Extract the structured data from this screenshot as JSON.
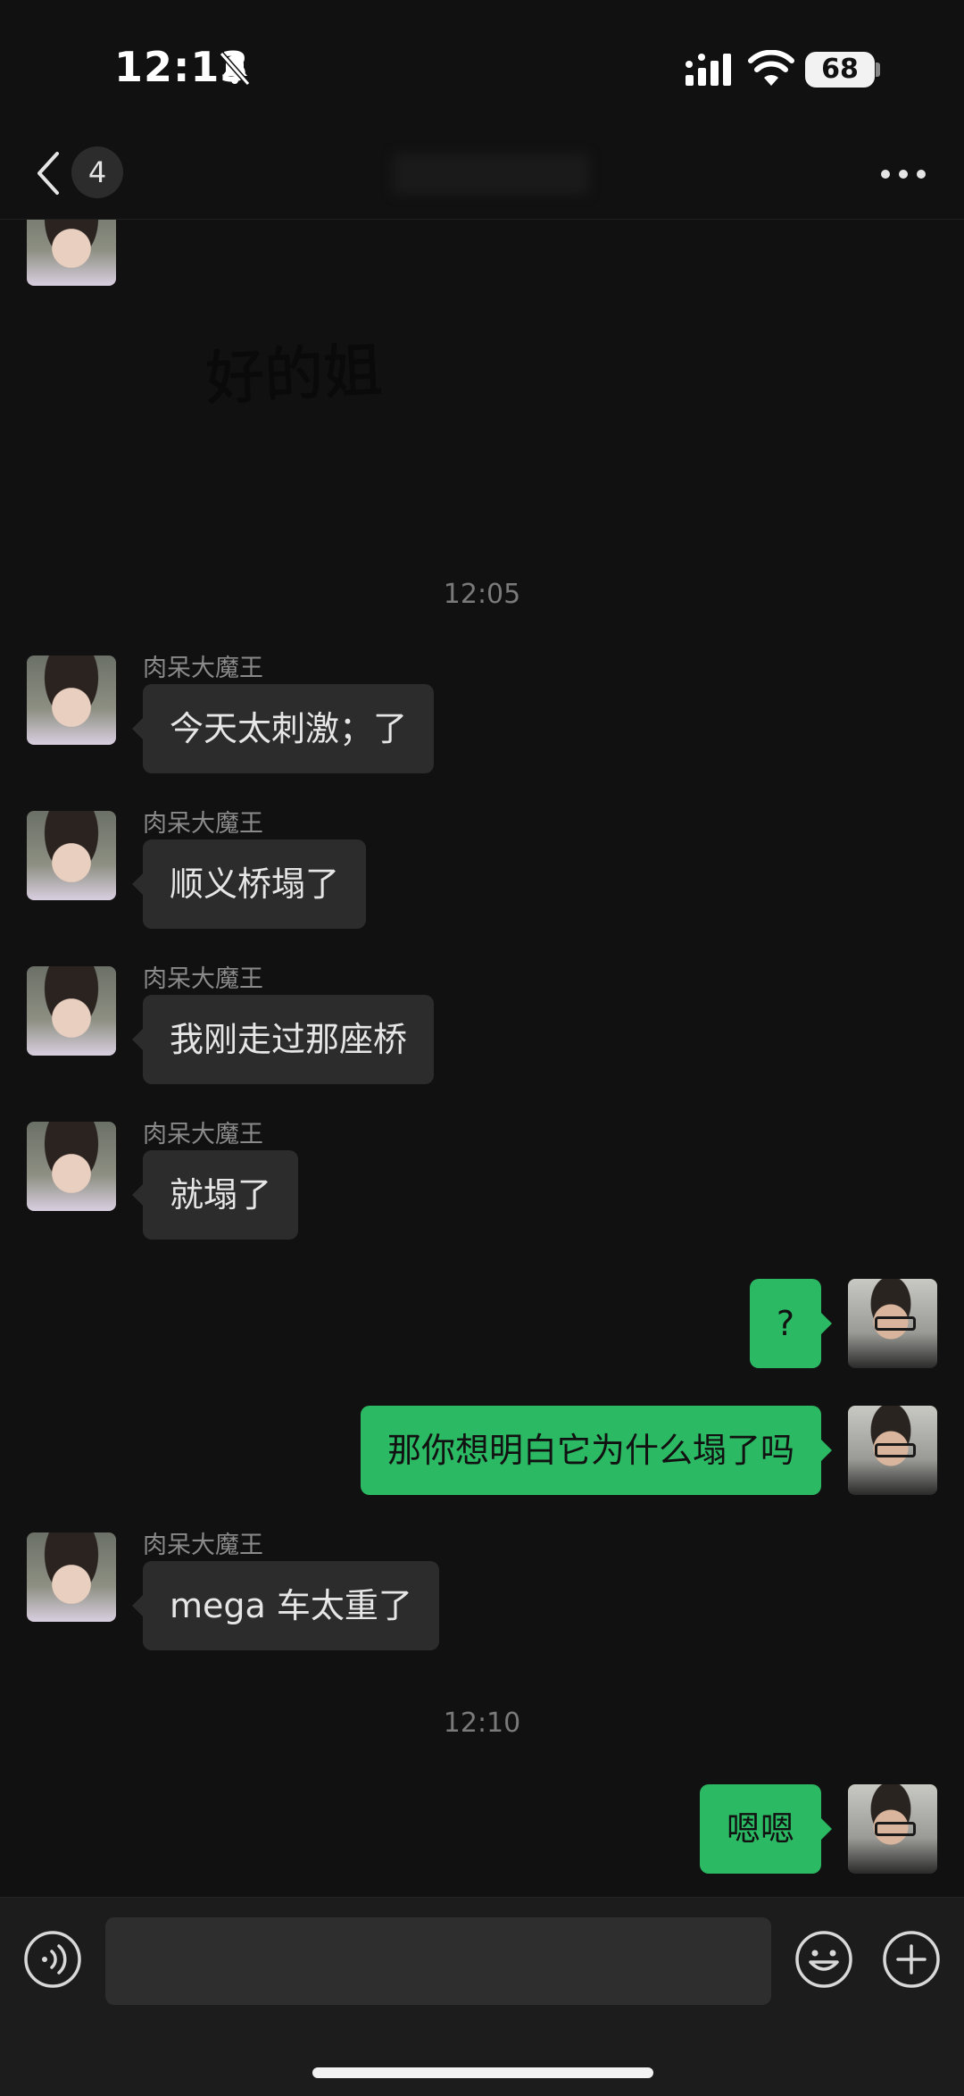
{
  "status_bar": {
    "time": "12:13",
    "battery": "68",
    "icons": [
      "bell-slash-icon",
      "cellular-signal-icon",
      "wifi-icon",
      "battery-icon"
    ]
  },
  "nav": {
    "unread_count": "4",
    "icons": [
      "chevron-left-icon",
      "more-icon"
    ]
  },
  "chat": {
    "sticker_text": "好的姐",
    "timestamps": [
      "12:05",
      "12:10"
    ],
    "messages": [
      {
        "direction": "in",
        "sender": "肉呆大魔王",
        "text": "今天太刺激；了"
      },
      {
        "direction": "in",
        "sender": "肉呆大魔王",
        "text": "顺义桥塌了"
      },
      {
        "direction": "in",
        "sender": "肉呆大魔王",
        "text": "我刚走过那座桥"
      },
      {
        "direction": "in",
        "sender": "肉呆大魔王",
        "text": "就塌了"
      },
      {
        "direction": "out",
        "text": "?"
      },
      {
        "direction": "out",
        "text": "那你想明白它为什么塌了吗"
      },
      {
        "direction": "in",
        "sender": "肉呆大魔王",
        "text": "mega 车太重了"
      },
      {
        "direction": "out",
        "text": "嗯嗯"
      }
    ]
  },
  "input_bar": {
    "placeholder": "",
    "icons": [
      "voice-icon",
      "emoji-icon",
      "plus-icon"
    ]
  },
  "colors": {
    "background": "#111111",
    "incoming_bubble": "#2c2c2c",
    "outgoing_bubble": "#2bb964",
    "input_bar": "#1c1c1c"
  }
}
